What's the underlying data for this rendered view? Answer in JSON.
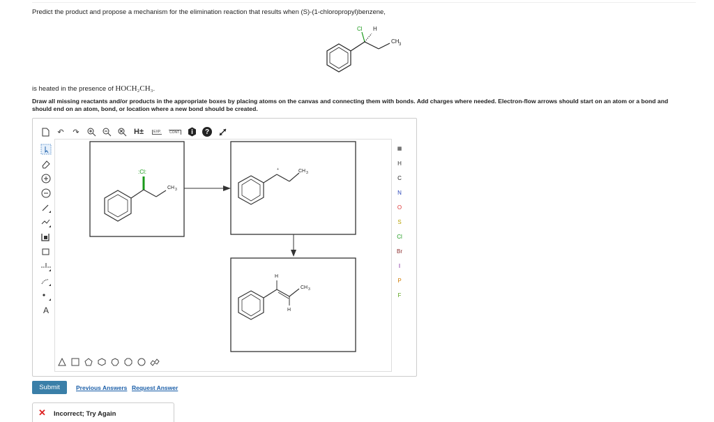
{
  "question": {
    "line1": "Predict the product and propose a mechanism for the elimination reaction that results when (S)-(1-chloropropyl)benzene,",
    "line2_before": "is heated in the presence of ",
    "line2_formula": "HOCH₂CH₃",
    "line2_after": ".",
    "instructions": "Draw all missing reactants and/or products in the appropriate boxes by placing atoms on the canvas and connecting them with bonds. Add charges where needed. Electron-flow arrows should start on an atom or a bond and should end on an atom, bond, or location where a new bond should be created."
  },
  "molecule_labels": {
    "cl": "Cl",
    "h": "H",
    "ch3": "CH",
    "three": "3",
    "lone_cl": ":Cl:"
  },
  "toolbar": {
    "undo": "↶",
    "redo": "↷",
    "hplus": "H±",
    "exp": "EXP.",
    "cont": "CONT.",
    "help": "?"
  },
  "atoms": [
    "H",
    "C",
    "N",
    "O",
    "S",
    "Cl",
    "Br",
    "I",
    "P",
    "F"
  ],
  "left_tools": {
    "text_tool": "A"
  },
  "actions": {
    "submit": "Submit",
    "previous_answers": "Previous Answers",
    "request_answer": "Request Answer"
  },
  "feedback": {
    "status": "Incorrect; Try Again"
  }
}
